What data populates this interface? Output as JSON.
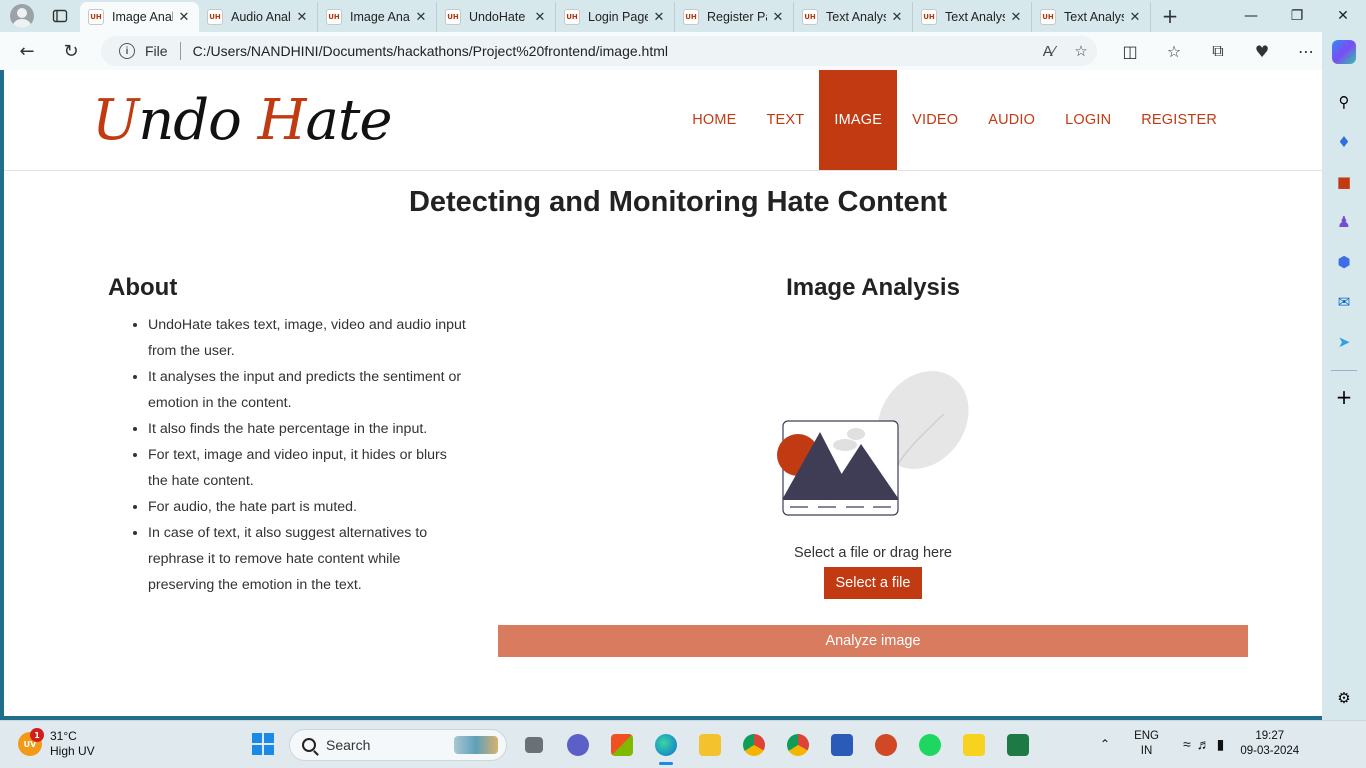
{
  "browser": {
    "tabs": [
      {
        "label": "Image Analysis",
        "active": true
      },
      {
        "label": "Audio Analysis"
      },
      {
        "label": "Image Analysis"
      },
      {
        "label": "UndoHate"
      },
      {
        "label": "Login Page"
      },
      {
        "label": "Register Page"
      },
      {
        "label": "Text Analysis"
      },
      {
        "label": "Text Analysis"
      },
      {
        "label": "Text Analysis"
      }
    ],
    "favicon_text": "UH",
    "address": {
      "scheme_label": "File",
      "url": "C:/Users/NANDHINI/Documents/hackathons/Project%20frontend/image.html"
    }
  },
  "site": {
    "logo": {
      "part1_cap": "U",
      "part1_rest": "ndo ",
      "part2_cap": "H",
      "part2_rest": "ate"
    },
    "nav": [
      {
        "label": "HOME"
      },
      {
        "label": "TEXT"
      },
      {
        "label": "IMAGE",
        "active": true
      },
      {
        "label": "VIDEO"
      },
      {
        "label": "AUDIO"
      },
      {
        "label": "LOGIN"
      },
      {
        "label": "REGISTER"
      }
    ],
    "hero_title": "Detecting and Monitoring Hate Content",
    "about": {
      "heading": "About",
      "items": [
        "UndoHate takes text, image, video and audio input from the user.",
        "It analyses the input and predicts the sentiment or emotion in the content.",
        "It also finds the hate percentage in the input.",
        "For text, image and video input, it hides or blurs the hate content.",
        "For audio, the hate part is muted.",
        "In case of text, it also suggest alternatives to rephrase it to remove hate content while preserving the emotion in the text."
      ]
    },
    "analysis": {
      "heading": "Image Analysis",
      "drop_text": "Select a file or drag here",
      "select_button": "Select a file",
      "analyze_button": "Analyze image"
    },
    "colors": {
      "accent": "#c23a12",
      "analyze_button": "#d87b5e"
    }
  },
  "taskbar": {
    "weather": {
      "temp": "31°C",
      "desc": "High UV",
      "badge": "1",
      "uv_label": "UV"
    },
    "search_placeholder": "Search",
    "lang_top": "ENG",
    "lang_bottom": "IN",
    "time": "19:27",
    "date": "09-03-2024"
  }
}
